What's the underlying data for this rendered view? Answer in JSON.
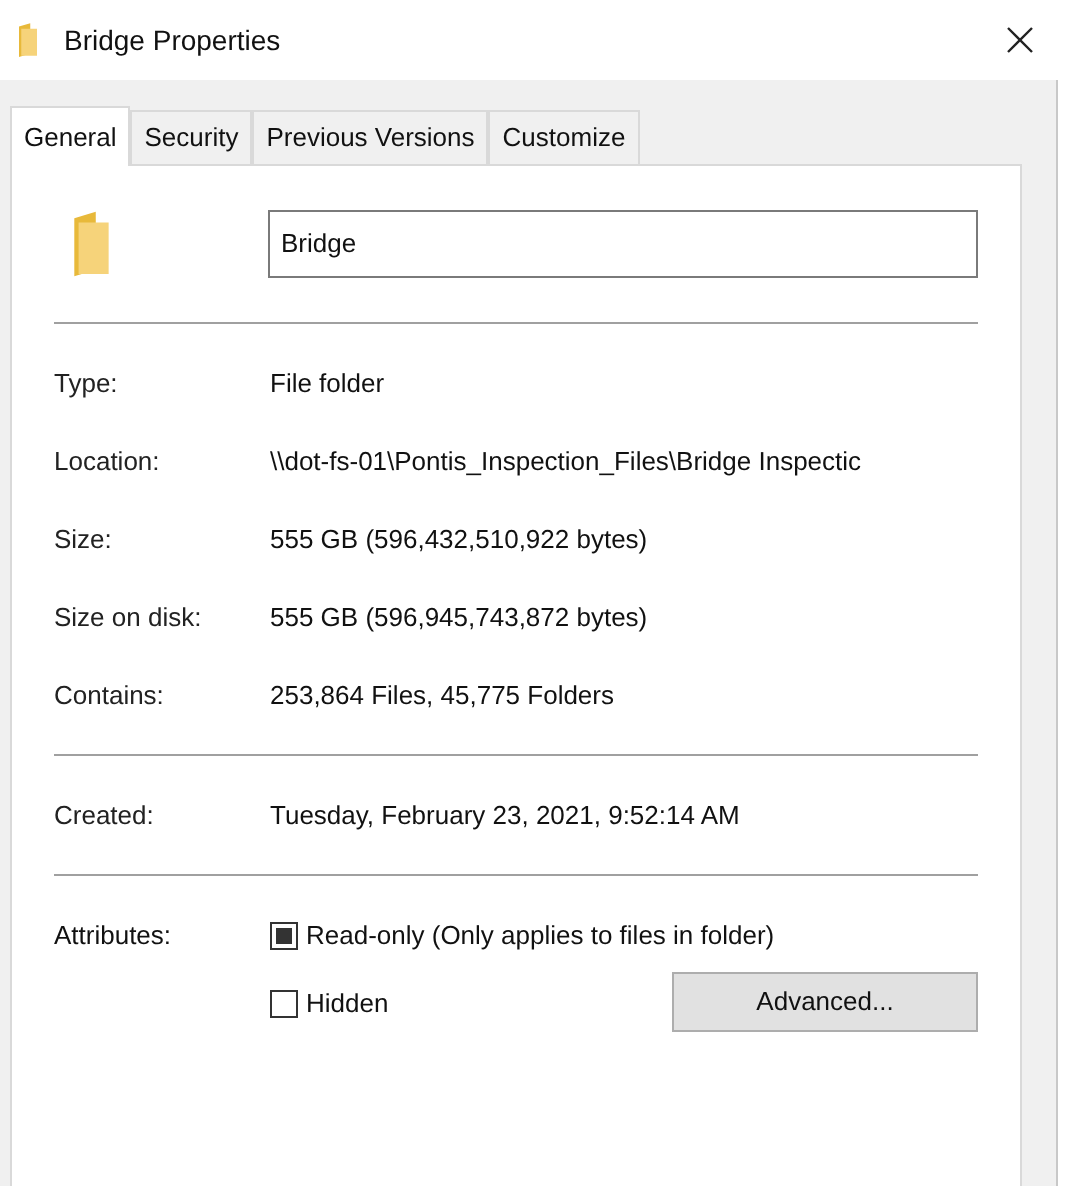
{
  "window": {
    "title": "Bridge Properties"
  },
  "tabs": [
    {
      "label": "General",
      "selected": true
    },
    {
      "label": "Security",
      "selected": false
    },
    {
      "label": "Previous Versions",
      "selected": false
    },
    {
      "label": "Customize",
      "selected": false
    }
  ],
  "name_field": {
    "value": "Bridge"
  },
  "groups": [
    [
      {
        "label": "Type:",
        "value": "File folder"
      },
      {
        "label": "Location:",
        "value": "\\\\dot-fs-01\\Pontis_Inspection_Files\\Bridge Inspectic"
      },
      {
        "label": "Size:",
        "value": "555 GB (596,432,510,922 bytes)"
      },
      {
        "label": "Size on disk:",
        "value": "555 GB (596,945,743,872 bytes)"
      },
      {
        "label": "Contains:",
        "value": "253,864 Files, 45,775 Folders"
      }
    ],
    [
      {
        "label": "Created:",
        "value": "Tuesday, February 23, 2021, 9:52:14 AM"
      }
    ]
  ],
  "attributes": {
    "label": "Attributes:",
    "options": [
      {
        "label": "Read-only (Only applies to files in folder)",
        "checked": false,
        "mixed": true
      },
      {
        "label": "Hidden",
        "checked": false,
        "mixed": false
      }
    ],
    "button": "Advanced..."
  }
}
